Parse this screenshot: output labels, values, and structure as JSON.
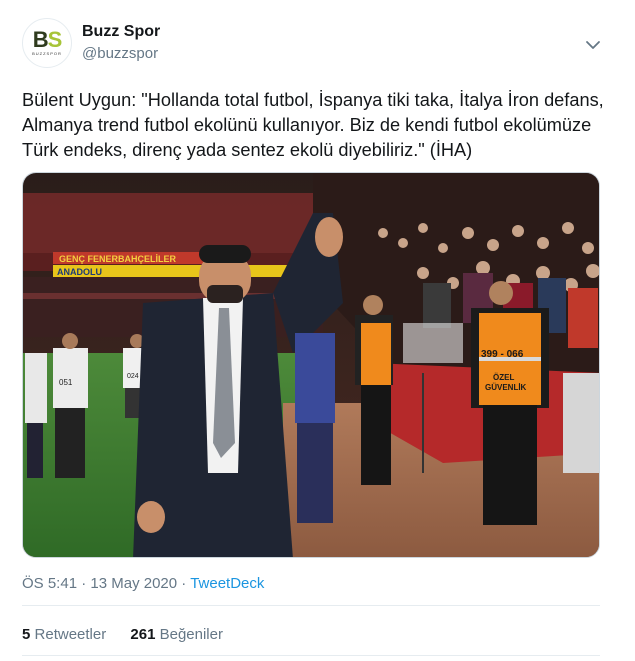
{
  "author": {
    "display_name": "Buzz Spor",
    "handle": "@buzzspor",
    "avatar_logo_b": "B",
    "avatar_logo_s": "S",
    "avatar_logo_sub": "BUZZSPOR"
  },
  "tweet": {
    "text": "Bülent Uygun: \"Hollanda total futbol, İspanya tiki taka, İtalya İron defans, Almanya trend futbol ekolünü kullanıyor. Biz de kendi futbol ekolümüze Türk endeks, direnç yada sentez ekolü diyebiliriz.\" (İHA)",
    "time": "ÖS 5:41",
    "separator": " · ",
    "date": "13 May 2020",
    "source": "TweetDeck"
  },
  "photo": {
    "banner_text": "GENÇ FENERBAHÇELİLER",
    "banner_text_2": "ANADOLU",
    "vest_number": "399 - 066",
    "vest_label_1": "ÖZEL",
    "vest_label_2": "GÜVENLİK",
    "bib_1": "051",
    "bib_2": "024"
  },
  "stats": {
    "retweets_count": "5",
    "retweets_label": "Retweetler",
    "likes_count": "261",
    "likes_label": "Beğeniler"
  },
  "colors": {
    "link": "#1b95e0",
    "secondary_text": "#657786",
    "vest_orange": "#f08a1c",
    "pitch_green": "#3e7a32"
  },
  "icons": {
    "caret": "chevron-down-icon"
  }
}
